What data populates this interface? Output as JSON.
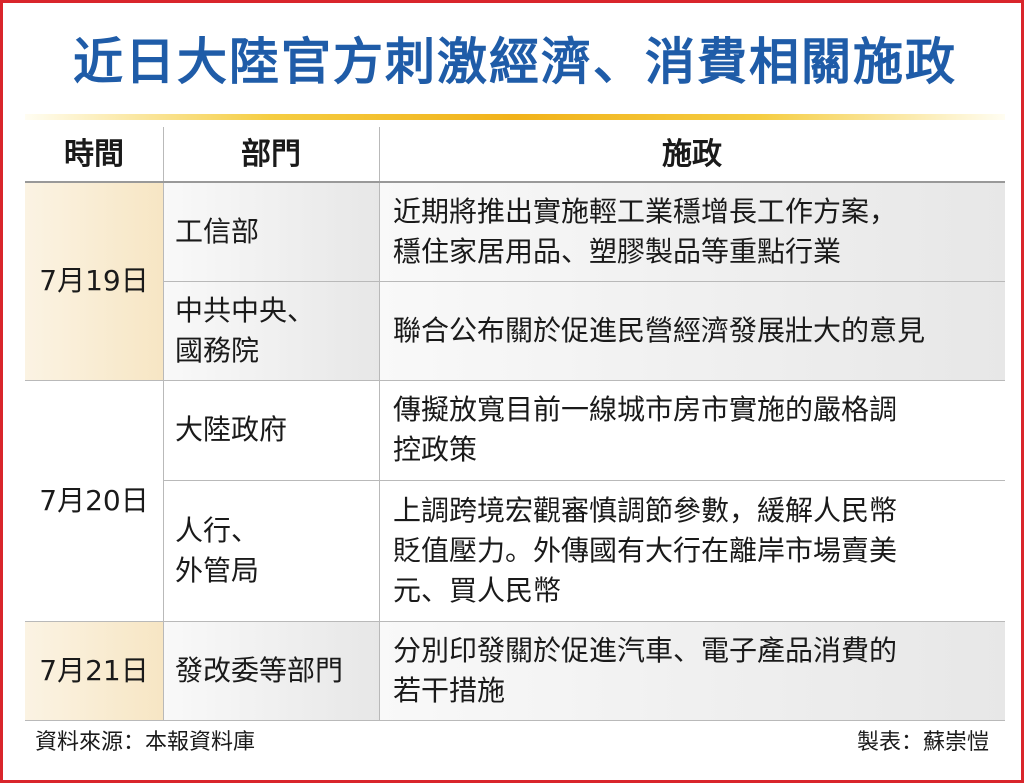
{
  "title": "近日大陸官方刺激經濟、消費相關施政",
  "headers": {
    "time": "時間",
    "dept": "部門",
    "policy": "施政"
  },
  "groups": [
    {
      "date": "7月19日"
    },
    {
      "date": "7月20日"
    },
    {
      "date": "7月21日"
    }
  ],
  "rows": [
    {
      "dept": [
        "工信部"
      ],
      "policy": [
        "近期將推出實施輕工業穩增長工作方案，",
        "穩住家居用品、塑膠製品等重點行業"
      ]
    },
    {
      "dept": [
        "中共中央、",
        "國務院"
      ],
      "policy": [
        "聯合公布關於促進民營經濟發展壯大的意見"
      ]
    },
    {
      "dept": [
        "大陸政府"
      ],
      "policy": [
        "傳擬放寬目前一線城市房市實施的嚴格調",
        "控政策"
      ]
    },
    {
      "dept": [
        "人行、",
        "外管局"
      ],
      "policy": [
        "上調跨境宏觀審慎調節參數，緩解人民幣",
        "貶值壓力。外傳國有大行在離岸市場賣美",
        "元、買人民幣"
      ]
    },
    {
      "dept": [
        "發改委等部門"
      ],
      "policy": [
        "分別印發關於促進汽車、電子產品消費的",
        "若干措施"
      ]
    }
  ],
  "footer": {
    "source": "資料來源：本報資料庫",
    "author": "製表：蘇崇愷"
  },
  "colors": {
    "frame": "#d9252b",
    "title": "#1f5ca8",
    "accent_bar": "#f1b21a",
    "date_bg": "#f7e6c4",
    "row_bg": "#e7e7e7"
  }
}
